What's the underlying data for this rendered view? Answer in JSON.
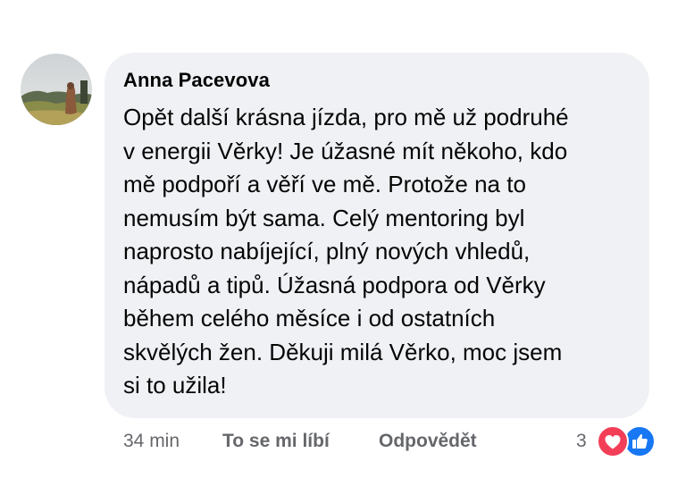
{
  "comment": {
    "author": "Anna Pacevova",
    "text_lines": [
      "Opět další krásna jízda, pro mě už podruhé",
      "v energii Věrky! Je úžasné mít někoho, kdo",
      "mě podpoří a věří ve mě. Protože na to",
      "nemusím být sama. Celý mentoring byl",
      "naprosto nabíjející, plný nových vhledů,",
      "nápadů a tipů. Úžasná podpora od Věrky",
      "během celého měsíce i od ostatních",
      "skvělých žen. Děkuji milá Věrko, moc jsem",
      "si to užila!"
    ]
  },
  "actions": {
    "time": "34 min",
    "like_label": "To se mi líbí",
    "reply_label": "Odpovědět",
    "reaction_count": "3"
  },
  "reactions": [
    {
      "icon": "heart-icon",
      "color": "#f33e58"
    },
    {
      "icon": "thumbs-up-icon",
      "color": "#1877f2"
    }
  ],
  "colors": {
    "bubble": "#eff1f4",
    "secondary_text": "#65676b",
    "primary_text": "#050505"
  }
}
